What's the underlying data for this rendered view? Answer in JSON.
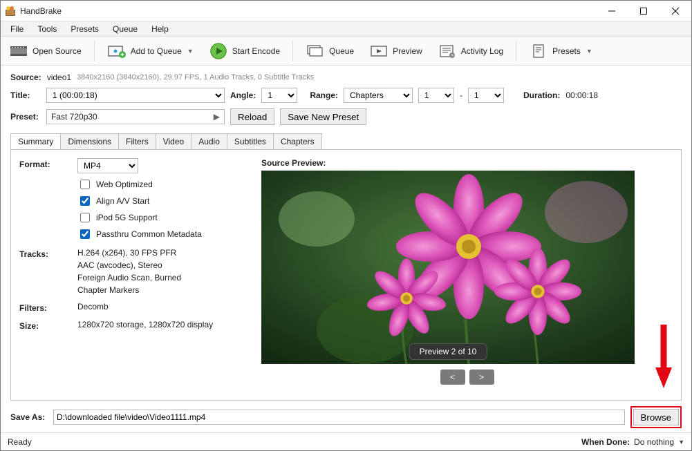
{
  "title": "HandBrake",
  "menu": [
    "File",
    "Tools",
    "Presets",
    "Queue",
    "Help"
  ],
  "toolbar": {
    "open_source": "Open Source",
    "add_to_queue": "Add to Queue",
    "start_encode": "Start Encode",
    "queue": "Queue",
    "preview": "Preview",
    "activity_log": "Activity Log",
    "presets": "Presets"
  },
  "source": {
    "label": "Source:",
    "name": "video1",
    "info": "3840x2160 (3840x2160), 29.97 FPS, 1 Audio Tracks, 0 Subtitle Tracks"
  },
  "title_row": {
    "title_lbl": "Title:",
    "title_value": "1  (00:00:18)",
    "angle_lbl": "Angle:",
    "angle_value": "1",
    "range_lbl": "Range:",
    "range_type": "Chapters",
    "range_from": "1",
    "range_sep": "-",
    "range_to": "1",
    "duration_lbl": "Duration:",
    "duration_value": "00:00:18"
  },
  "preset_row": {
    "label": "Preset:",
    "value": "Fast 720p30",
    "reload": "Reload",
    "save_new": "Save New Preset"
  },
  "tabs": [
    "Summary",
    "Dimensions",
    "Filters",
    "Video",
    "Audio",
    "Subtitles",
    "Chapters"
  ],
  "summary": {
    "format_lbl": "Format:",
    "format_value": "MP4",
    "checks": {
      "web_optimized": {
        "label": "Web Optimized",
        "checked": false
      },
      "align_av": {
        "label": "Align A/V Start",
        "checked": true
      },
      "ipod5g": {
        "label": "iPod 5G Support",
        "checked": false
      },
      "passthru_meta": {
        "label": "Passthru Common Metadata",
        "checked": true
      }
    },
    "tracks_lbl": "Tracks:",
    "tracks": [
      "H.264 (x264), 30 FPS PFR",
      "AAC (avcodec), Stereo",
      "Foreign Audio Scan, Burned",
      "Chapter Markers"
    ],
    "filters_lbl": "Filters:",
    "filters_value": "Decomb",
    "size_lbl": "Size:",
    "size_value": "1280x720 storage, 1280x720 display",
    "preview_lbl": "Source Preview:",
    "preview_badge": "Preview 2 of 10"
  },
  "saveas": {
    "label": "Save As:",
    "path": "D:\\downloaded file\\video\\Video1111.mp4",
    "browse": "Browse"
  },
  "status": {
    "ready": "Ready",
    "when_done_lbl": "When Done:",
    "when_done_value": "Do nothing"
  }
}
